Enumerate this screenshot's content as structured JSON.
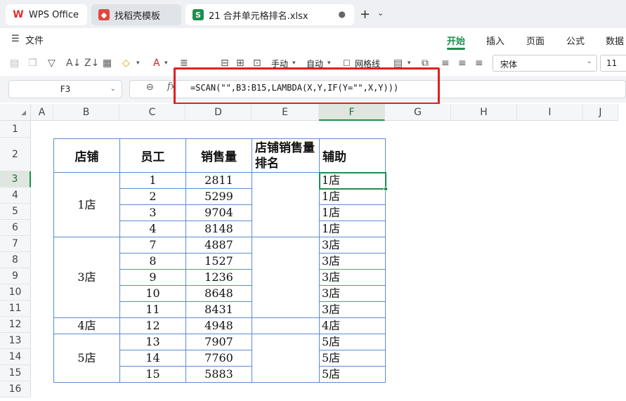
{
  "tabs": [
    {
      "label": "WPS Office",
      "icon": "wps-logo-icon"
    },
    {
      "label": "找稻壳模板",
      "icon": "docer-icon"
    },
    {
      "label": "21 合并单元格排名.xlsx",
      "icon": "spreadsheet-icon",
      "active": true
    }
  ],
  "menu": {
    "file_label": "文件",
    "ribbon_tabs": [
      "开始",
      "插入",
      "页面",
      "公式",
      "数据"
    ],
    "active_tab": "开始"
  },
  "toolbar": {
    "wrap_label": "手动",
    "auto_label": "自动",
    "gridlines_label": "网格线",
    "font_name": "宋体",
    "font_size": "11"
  },
  "formula_bar": {
    "name_box": "F3",
    "fx_label": "fx",
    "formula": "=SCAN(\"\",B3:B15,LAMBDA(X,Y,IF(Y=\"\",X,Y)))"
  },
  "grid": {
    "columns": [
      "A",
      "B",
      "C",
      "D",
      "E",
      "F",
      "G",
      "H",
      "I",
      "J"
    ],
    "rows": [
      "1",
      "2",
      "3",
      "4",
      "5",
      "6",
      "7",
      "8",
      "9",
      "10",
      "11",
      "12",
      "13",
      "14",
      "15",
      "16"
    ],
    "selected_column": "F",
    "selected_row": "3"
  },
  "table": {
    "headers": [
      "店铺",
      "员工",
      "销售量",
      "店铺销售量排名",
      "辅助"
    ],
    "stores": [
      {
        "name": "1店",
        "rows": [
          [
            "1",
            "2811",
            "1店"
          ],
          [
            "2",
            "5299",
            "1店"
          ],
          [
            "3",
            "9704",
            "1店"
          ],
          [
            "4",
            "8148",
            "1店"
          ]
        ]
      },
      {
        "name": "3店",
        "rows": [
          [
            "7",
            "4887",
            "3店"
          ],
          [
            "8",
            "1527",
            "3店"
          ],
          [
            "9",
            "1236",
            "3店"
          ],
          [
            "10",
            "8648",
            "3店"
          ],
          [
            "11",
            "8431",
            "3店"
          ]
        ]
      },
      {
        "name": "4店",
        "rows": [
          [
            "12",
            "4948",
            "4店"
          ]
        ]
      },
      {
        "name": "5店",
        "rows": [
          [
            "13",
            "7907",
            "5店"
          ],
          [
            "14",
            "7760",
            "5店"
          ],
          [
            "15",
            "5883",
            "5店"
          ]
        ]
      }
    ]
  },
  "colors": {
    "accent": "#1f8f4e",
    "highlight": "#e02020",
    "table_border": "#5b8bd0"
  }
}
